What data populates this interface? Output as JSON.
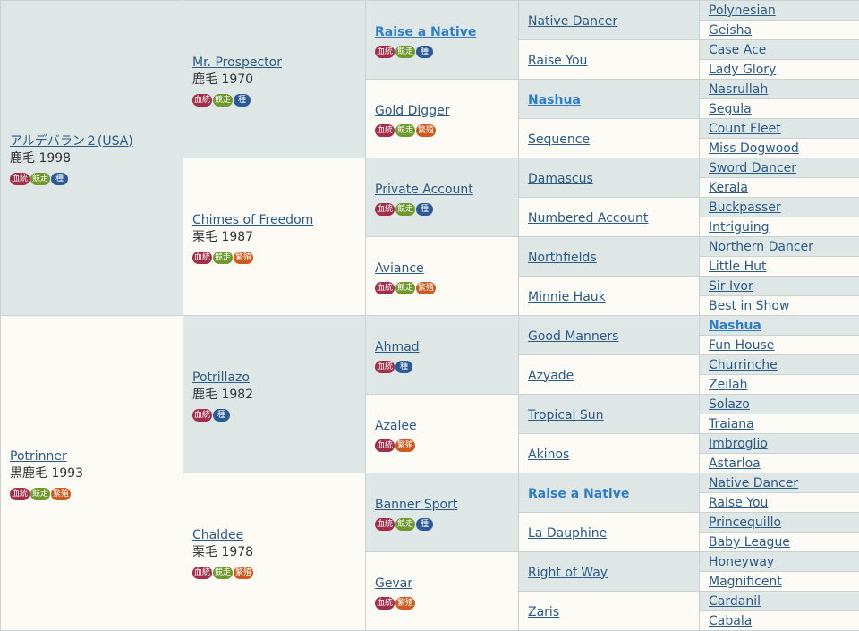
{
  "badge_labels": {
    "kettou": "血統",
    "kyousou": "競走",
    "shu": "種",
    "hanshoku": "繁殖"
  },
  "gen1": [
    {
      "name": "アルデバラン２(USA)",
      "info": "鹿毛 1998"
    },
    {
      "name": "Potrinner",
      "info": "黒鹿毛 1993"
    }
  ],
  "gen2": [
    {
      "name": "Mr. Prospector",
      "info": "鹿毛 1970"
    },
    {
      "name": "Chimes of Freedom",
      "info": "栗毛 1987"
    },
    {
      "name": "Potrillazo",
      "info": "鹿毛 1982"
    },
    {
      "name": "Chaldee",
      "info": "栗毛 1978"
    }
  ],
  "gen3": [
    {
      "name": "Raise a Native"
    },
    {
      "name": "Gold Digger"
    },
    {
      "name": "Private Account"
    },
    {
      "name": "Aviance"
    },
    {
      "name": "Ahmad"
    },
    {
      "name": "Azalee"
    },
    {
      "name": "Banner Sport"
    },
    {
      "name": "Gevar"
    }
  ],
  "gen4": [
    "Native Dancer",
    "Raise You",
    "Nashua",
    "Sequence",
    "Damascus",
    "Numbered Account",
    "Northfields",
    "Minnie Hauk",
    "Good Manners",
    "Azyade",
    "Tropical Sun",
    "Akinos",
    "Raise a Native",
    "La Dauphine",
    "Right of Way",
    "Zaris"
  ],
  "gen5": [
    "Polynesian",
    "Geisha",
    "Case Ace",
    "Lady Glory",
    "Nasrullah",
    "Segula",
    "Count Fleet",
    "Miss Dogwood",
    "Sword Dancer",
    "Kerala",
    "Buckpasser",
    "Intriguing",
    "Northern Dancer",
    "Little Hut",
    "Sir Ivor",
    "Best in Show",
    "Nashua",
    "Fun House",
    "Churrinche",
    "Zeilah",
    "Solazo",
    "Traiana",
    "Imbroglio",
    "Astarloa",
    "Native Dancer",
    "Raise You",
    "Princequillo",
    "Baby League",
    "Honeyway",
    "Magnificent",
    "Cardanil",
    "Cabala"
  ]
}
